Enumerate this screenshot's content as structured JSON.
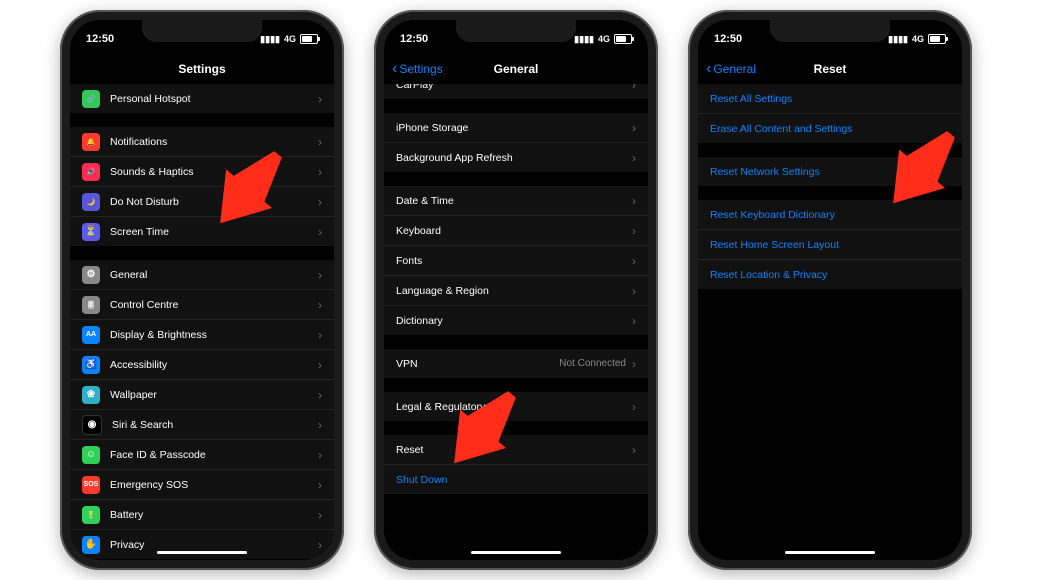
{
  "status": {
    "time": "12:50",
    "network": "4G"
  },
  "phone1": {
    "title": "Settings",
    "groups": [
      {
        "items": [
          {
            "icon": "link",
            "bg": "bg-green",
            "label": "Personal Hotspot"
          }
        ]
      },
      {
        "items": [
          {
            "icon": "bell",
            "bg": "bg-red",
            "label": "Notifications"
          },
          {
            "icon": "speaker",
            "bg": "bg-fuchsia",
            "label": "Sounds & Haptics"
          },
          {
            "icon": "moon",
            "bg": "bg-purple",
            "label": "Do Not Disturb"
          },
          {
            "icon": "hourglass",
            "bg": "bg-indigo",
            "label": "Screen Time"
          }
        ]
      },
      {
        "items": [
          {
            "icon": "gear",
            "bg": "bg-gray",
            "label": "General"
          },
          {
            "icon": "toggles",
            "bg": "bg-gray",
            "label": "Control Centre"
          },
          {
            "icon": "AA",
            "bg": "bg-blue",
            "label": "Display & Brightness"
          },
          {
            "icon": "person",
            "bg": "bg-blue",
            "label": "Accessibility"
          },
          {
            "icon": "flower",
            "bg": "bg-teal",
            "label": "Wallpaper"
          },
          {
            "icon": "siri",
            "bg": "bg-black",
            "label": "Siri & Search"
          },
          {
            "icon": "faceid",
            "bg": "bg-green2",
            "label": "Face ID & Passcode"
          },
          {
            "icon": "SOS",
            "bg": "bg-red",
            "label": "Emergency SOS"
          },
          {
            "icon": "battery",
            "bg": "bg-green2",
            "label": "Battery"
          },
          {
            "icon": "hand",
            "bg": "bg-blue",
            "label": "Privacy"
          }
        ]
      }
    ]
  },
  "phone2": {
    "title": "General",
    "back": "Settings",
    "groups": [
      {
        "items": [
          {
            "label": "CarPlay"
          }
        ],
        "clip": true
      },
      {
        "items": [
          {
            "label": "iPhone Storage"
          },
          {
            "label": "Background App Refresh"
          }
        ]
      },
      {
        "items": [
          {
            "label": "Date & Time"
          },
          {
            "label": "Keyboard"
          },
          {
            "label": "Fonts"
          },
          {
            "label": "Language & Region"
          },
          {
            "label": "Dictionary"
          }
        ]
      },
      {
        "items": [
          {
            "label": "VPN",
            "detail": "Not Connected"
          }
        ]
      },
      {
        "items": [
          {
            "label": "Legal & Regulatory"
          }
        ]
      },
      {
        "items": [
          {
            "label": "Reset"
          },
          {
            "label": "Shut Down",
            "blue": true,
            "nochev": true
          }
        ]
      }
    ]
  },
  "phone3": {
    "title": "Reset",
    "back": "General",
    "groups": [
      {
        "items": [
          {
            "label": "Reset All Settings",
            "blue": true,
            "nochev": true
          },
          {
            "label": "Erase All Content and Settings",
            "blue": true,
            "nochev": true
          }
        ]
      },
      {
        "items": [
          {
            "label": "Reset Network Settings",
            "blue": true,
            "nochev": true
          }
        ]
      },
      {
        "items": [
          {
            "label": "Reset Keyboard Dictionary",
            "blue": true,
            "nochev": true
          },
          {
            "label": "Reset Home Screen Layout",
            "blue": true,
            "nochev": true
          },
          {
            "label": "Reset Location & Privacy",
            "blue": true,
            "nochev": true
          }
        ]
      }
    ]
  },
  "icons": {
    "link": "🔗",
    "bell": "🔔",
    "speaker": "🔊",
    "moon": "🌙",
    "hourglass": "⏳",
    "gear": "⚙",
    "toggles": "🎚",
    "AA": "AA",
    "person": "♿",
    "flower": "❀",
    "siri": "◉",
    "faceid": "☺",
    "SOS": "SOS",
    "battery": "🔋",
    "hand": "✋"
  }
}
